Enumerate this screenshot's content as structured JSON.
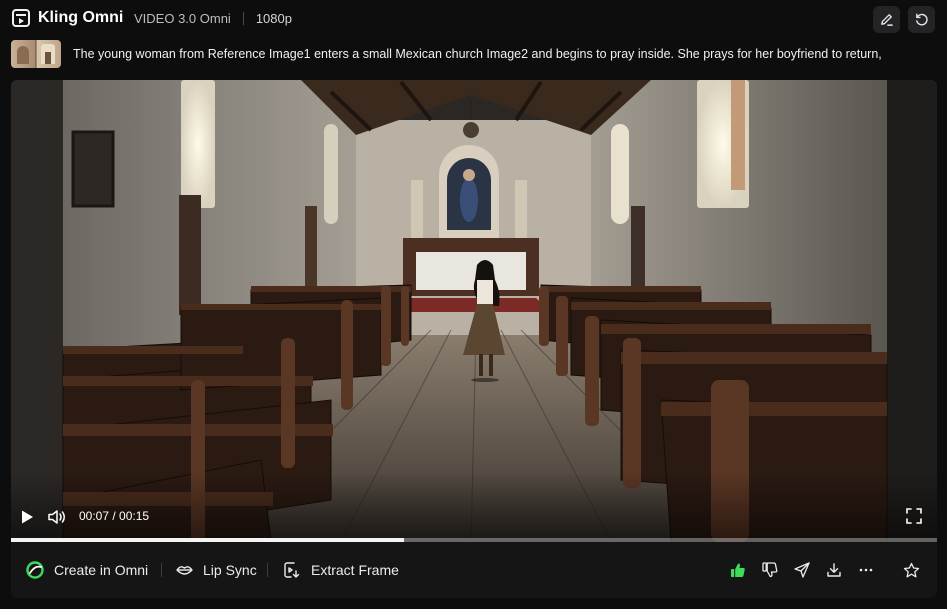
{
  "header": {
    "app_name": "Kling Omni",
    "model": "VIDEO 3.0 Omni",
    "resolution": "1080p",
    "edit_icon": "pencil-icon",
    "reset_icon": "undo-icon"
  },
  "prompt": {
    "text": "The young woman from Reference Image1 enters a small Mexican church Image2 and begins to pray inside. She prays for her boyfriend to return,"
  },
  "video": {
    "current_time": "00:07",
    "duration": "00:15",
    "time_separator": " / ",
    "progress": 0.424,
    "controls": {
      "play_icon": "play-icon",
      "volume_icon": "volume-icon",
      "fullscreen_icon": "fullscreen-icon"
    }
  },
  "toolbar": {
    "create_label": "Create in Omni",
    "lip_sync_label": "Lip Sync",
    "extract_label": "Extract Frame",
    "like_active": true,
    "colors": {
      "accent_green": "#3ddc5b",
      "bg": "#151516"
    }
  }
}
